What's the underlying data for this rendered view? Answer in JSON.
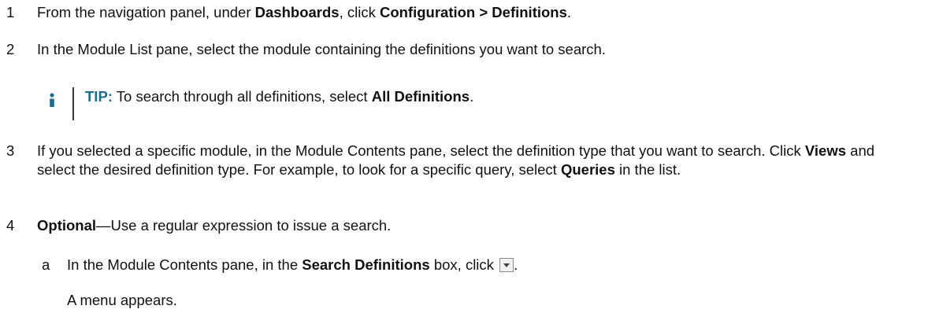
{
  "steps": [
    {
      "num": "1",
      "parts": [
        "From the navigation panel, under ",
        "Dashboards",
        ", click ",
        "Configuration > Definitions",
        "."
      ]
    },
    {
      "num": "2",
      "text": "In the Module List pane, select the module containing the definitions you want to search."
    },
    {
      "num": "3",
      "parts": [
        "If you selected a specific module, in the Module Contents pane, select the definition type that you want to search. Click ",
        "Views",
        " and select the desired definition type. For example, to look for a specific query, select ",
        "Queries",
        " in the list."
      ]
    },
    {
      "num": "4",
      "parts": [
        "Optional",
        "—Use a regular expression to issue a search."
      ]
    }
  ],
  "tip": {
    "label": "TIP:",
    "parts": [
      " To search through all definitions, select ",
      "All Definitions",
      "."
    ],
    "icon": "info-icon",
    "accent_color": "#1a6f8f"
  },
  "substep": {
    "letter": "a",
    "parts": [
      "In the Module Contents pane, in the ",
      "Search Definitions",
      " box, click ",
      "."
    ],
    "button_icon": "dropdown-arrow-icon",
    "result": "A menu appears."
  }
}
